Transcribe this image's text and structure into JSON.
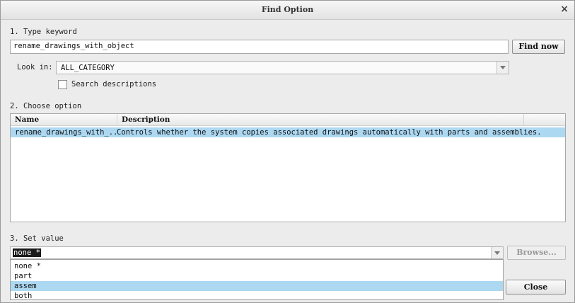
{
  "window": {
    "title": "Find Option",
    "close_glyph": "×"
  },
  "step1": {
    "label": "1.  Type keyword",
    "keyword_value": "rename_drawings_with_object",
    "find_button": "Find now",
    "look_in_label": "Look in:",
    "look_in_value": "ALL_CATEGORY",
    "search_descriptions_label": "Search descriptions",
    "search_descriptions_checked": false
  },
  "step2": {
    "label": "2.  Choose option",
    "columns": [
      "Name",
      "Description"
    ],
    "rows": [
      {
        "name": "rename_drawings_with_...",
        "description": "Controls whether the system copies associated drawings automatically with parts and assemblies."
      }
    ]
  },
  "step3": {
    "label": "3.  Set value",
    "current_value": "none *",
    "browse_button": "Browse...",
    "options": [
      "none *",
      "part",
      "assem",
      "both"
    ],
    "highlighted_option": "assem"
  },
  "footer": {
    "close_button": "Close"
  },
  "colors": {
    "selection": "#add8f2",
    "background": "#ececec"
  }
}
